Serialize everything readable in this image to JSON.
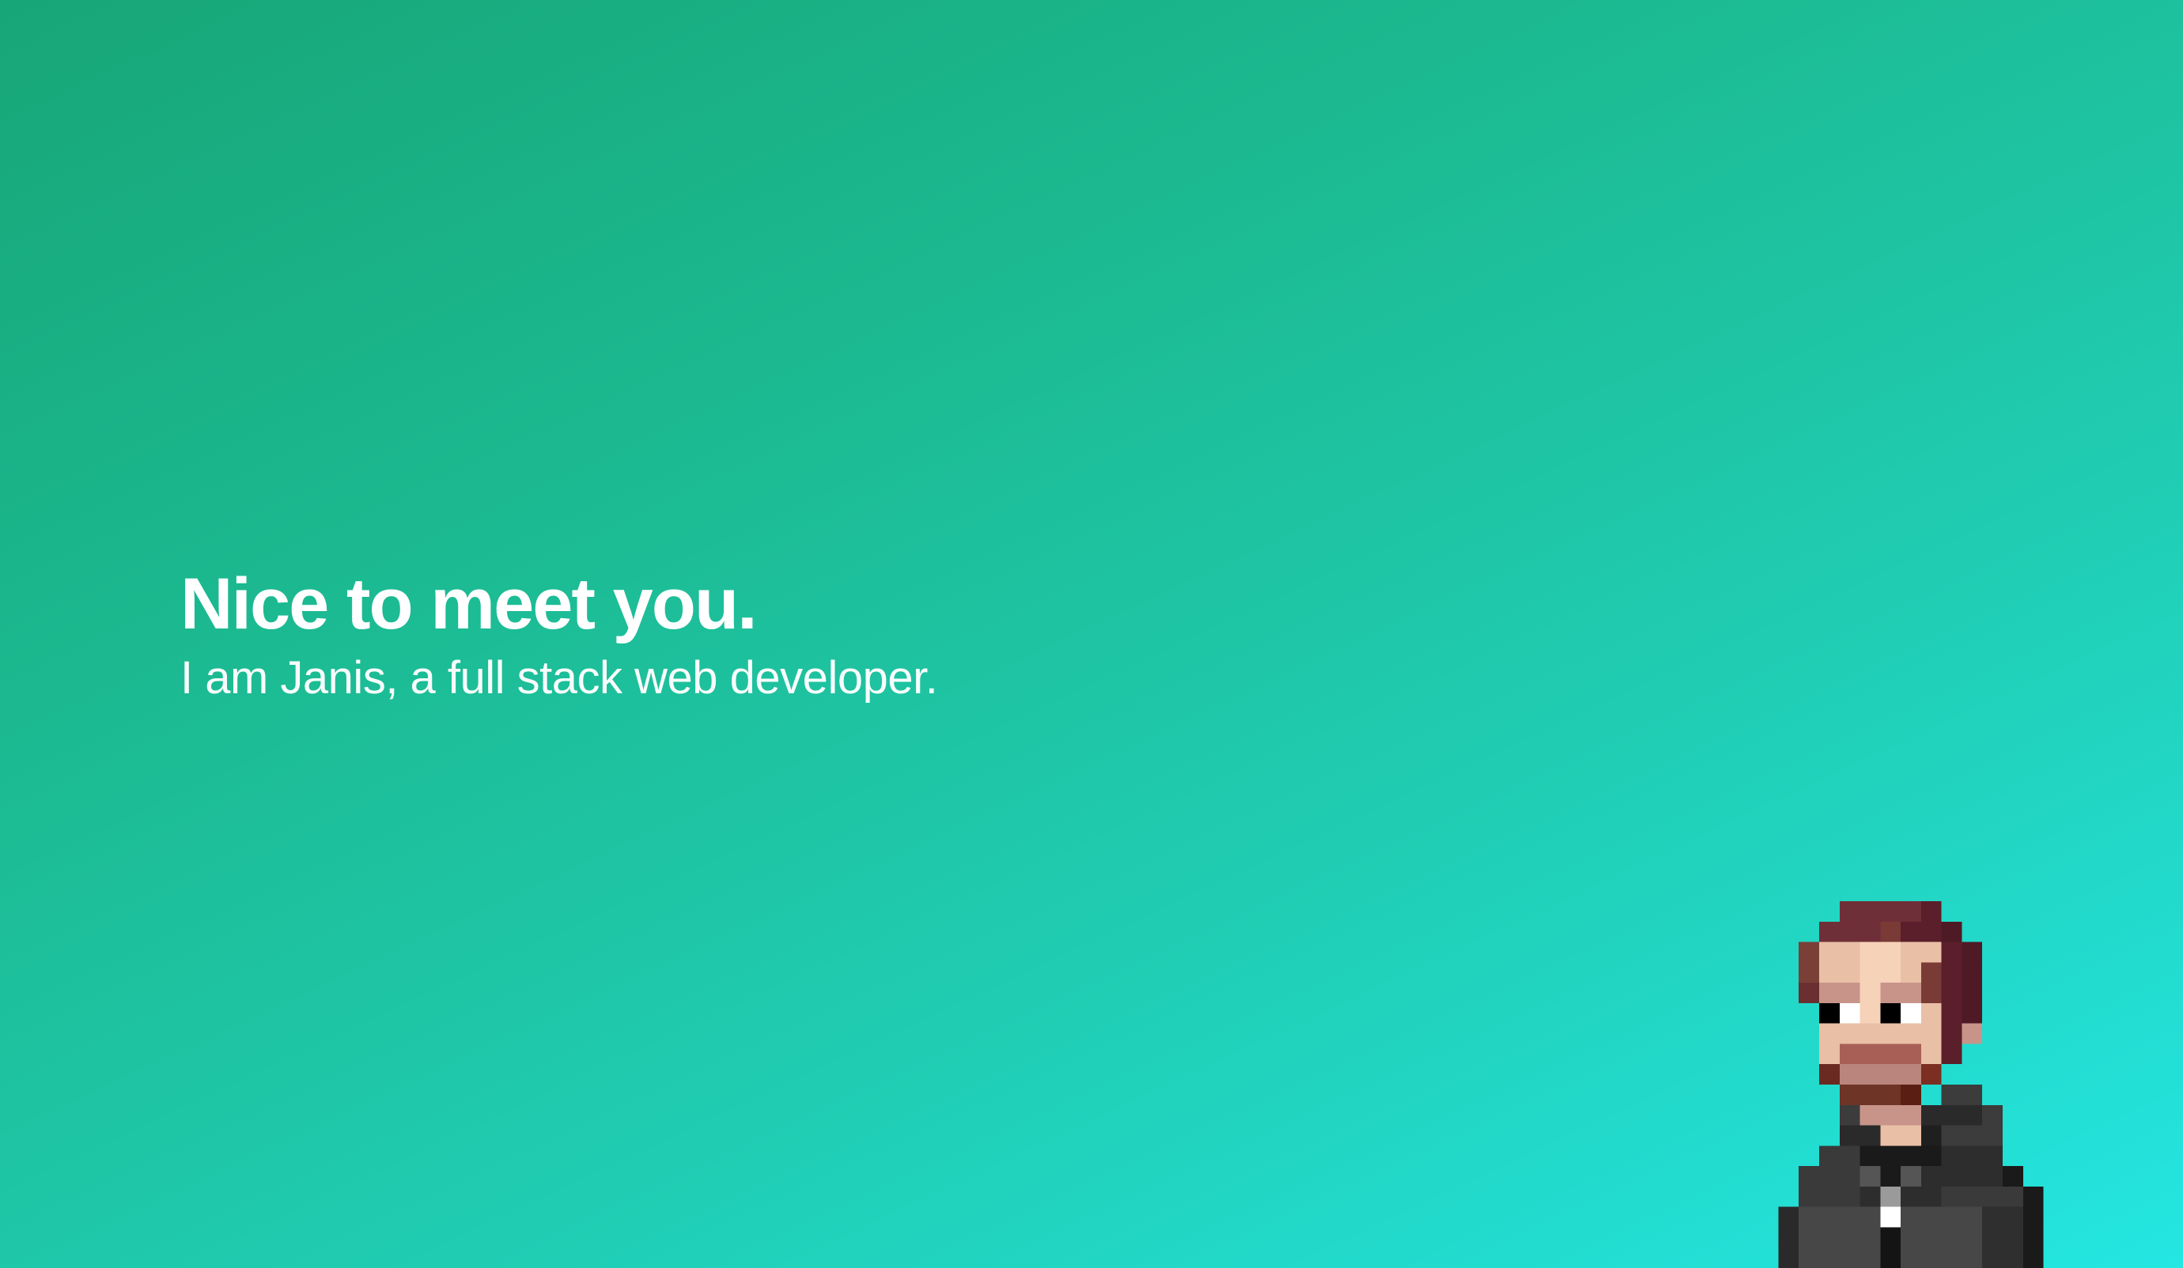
{
  "hero": {
    "title": "Nice to meet you.",
    "subtitle": "I am Janis, a full stack web developer."
  },
  "avatar": {
    "icon": "pixel-avatar-icon"
  },
  "colors": {
    "gradient_start": "#17a677",
    "gradient_end": "#24e6e2",
    "text": "#ffffff"
  }
}
